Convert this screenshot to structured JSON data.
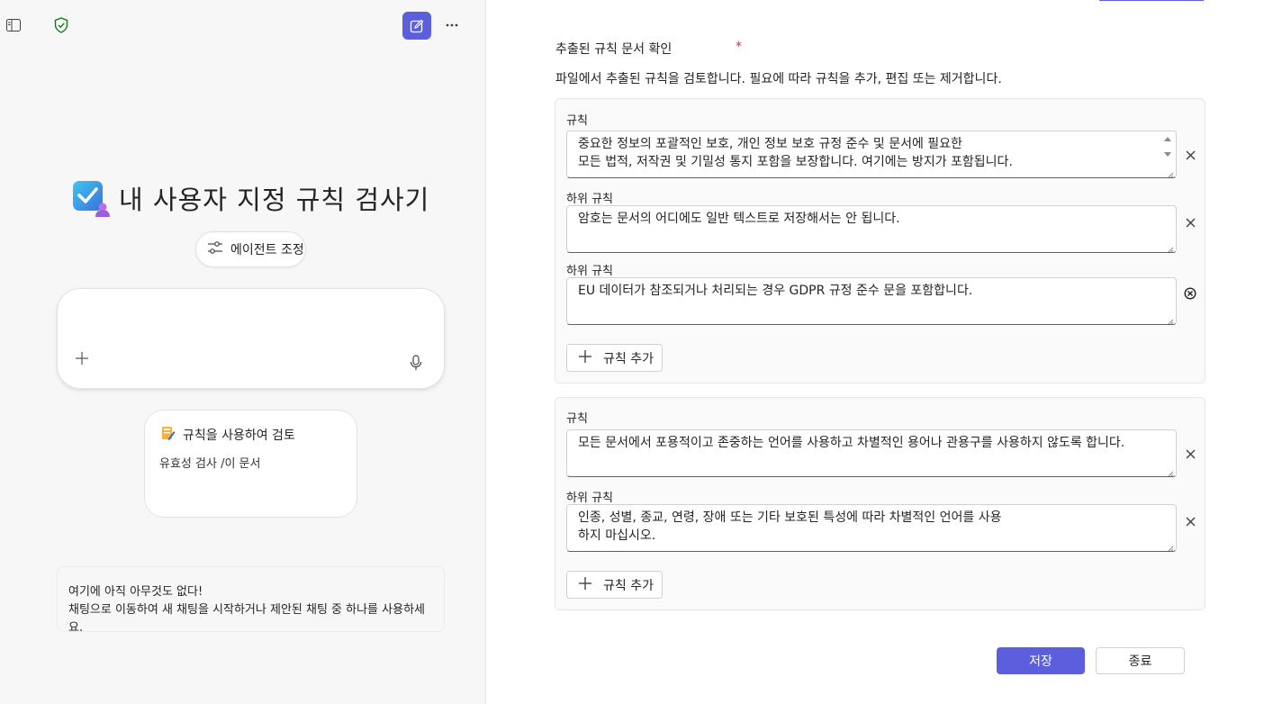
{
  "left": {
    "hero_title": "내 사용자 지정 규칙 검사기",
    "agent_button": "에이전트 조정",
    "suggestion": {
      "title": "규칙을 사용하여 검토",
      "subtitle": "유효성 검사 /이 문서"
    },
    "empty": {
      "line1": "여기에 아직 아무것도 없다!",
      "line2": "채팅으로 이동하여 새 채팅을 시작하거나 제안된 채팅 중 하나를 사용하세요."
    },
    "icons": [
      "sidebar-icon",
      "shield-check-icon",
      "compose-icon",
      "more-icon",
      "plus-icon",
      "mic-icon",
      "tune-icon"
    ]
  },
  "right": {
    "title": "추출된 규칙 문서 확인",
    "required_mark": "*",
    "description": "파일에서 추출된 규칙을 검토합니다. 필요에 따라 규칙을 추가, 편집 또는 제거합니다.",
    "groups": [
      {
        "rule_label": "규칙",
        "rule_line1": "중요한 정보의 포괄적인 보호, 개인 정보 보호 규정 준수 및 문서에 필요한",
        "rule_line2": "모든 법적, 저작권 및 기밀성 통지 포함을 보장합니다. 여기에는 방지가 포함됩니다.",
        "sub_label_1": "하위 규칙",
        "sub_1": "암호는 문서의 어디에도 일반 텍스트로 저장해서는 안 됩니다.",
        "sub_label_2": "하위 규칙",
        "sub_2": "EU 데이터가 참조되거나 처리되는 경우 GDPR 규정 준수 문을 포함합니다.",
        "add_label": "규칙 추가"
      },
      {
        "rule_label": "규칙",
        "rule_line1": "모든 문서에서 포용적이고 존중하는 언어를 사용하고 차별적인 용어나 관용구를 사용하지 않도록 합니다.",
        "sub_label_1": "하위 규칙",
        "sub_1_line1": "인종, 성별, 종교, 연령, 장애 또는 기타 보호된 특성에 따라 차별적인 언어를 사용",
        "sub_1_line2": "하지 마십시오.",
        "add_label": "규칙 추가"
      }
    ],
    "save_label": "저장",
    "close_label": "종료"
  },
  "colors": {
    "accent": "#5b5fde",
    "required": "#c4314b",
    "shield": "#107c10"
  }
}
